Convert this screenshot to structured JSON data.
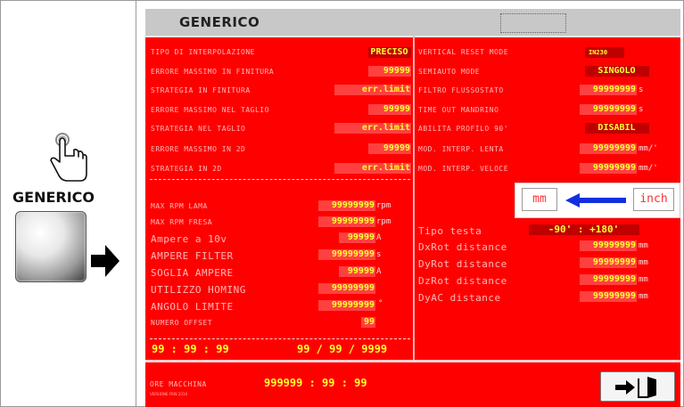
{
  "left": {
    "label": "GENERICO",
    "icon": "pointer-hand-icon",
    "button_icon": "gray-button-icon",
    "arrow_icon": "right-arrow-icon"
  },
  "title": {
    "text": "GENERICO"
  },
  "left_params": [
    {
      "label": "TIPO DI INTERPOLAZIONE",
      "value": "PRECISO"
    },
    {
      "label": "ERRORE MASSIMO IN FINITURA",
      "value": "99999"
    },
    {
      "label": "STRATEGIA IN FINITURA",
      "value": "err.limit"
    },
    {
      "label": "ERRORE MASSIMO NEL TAGLIO",
      "value": "99999"
    },
    {
      "label": "STRATEGIA NEL TAGLIO",
      "value": "err.limit"
    },
    {
      "label": "ERRORE MASSIMO IN 2D",
      "value": "99999"
    },
    {
      "label": "STRATEGIA IN 2D",
      "value": "err.limit"
    }
  ],
  "machine_params": [
    {
      "label": "MAX RPM LAMA",
      "value": "99999999",
      "unit": "rpm"
    },
    {
      "label": "MAX RPM FRESA",
      "value": "99999999",
      "unit": "rpm"
    },
    {
      "label": "Ampere a 10v",
      "value": "99999",
      "unit": "A"
    },
    {
      "label": "AMPERE FILTER",
      "value": "99999999",
      "unit": "s"
    },
    {
      "label": "SOGLIA AMPERE",
      "value": "99999",
      "unit": "A"
    },
    {
      "label": "UTILIZZO HOMING",
      "value": "99999999",
      "unit": ""
    },
    {
      "label": "ANGOLO LIMITE",
      "value": "99999999",
      "unit": "°"
    },
    {
      "label": "NUMERO OFFSET",
      "value": "99",
      "unit": ""
    }
  ],
  "time_display": "99 : 99 : 99",
  "date_display": "99 / 99 / 9999",
  "right_params": [
    {
      "label": "VERTICAL RESET MODE",
      "value": "IN230"
    },
    {
      "label": "SEMIAUTO MODE",
      "value": "SINGOLO"
    },
    {
      "label": "FILTRO FLUSSOSTATO",
      "value": "99999999",
      "unit": "s"
    },
    {
      "label": "TIME OUT MANDRINO",
      "value": "99999999",
      "unit": "s"
    },
    {
      "label": "ABILITA PROFILO 90'",
      "value": "DISABIL"
    },
    {
      "label": "MOD. INTERP. LENTA",
      "value": "99999999",
      "unit": "mm/'"
    },
    {
      "label": "MOD. INTERP. VELOCE",
      "value": "99999999",
      "unit": "mm/'"
    }
  ],
  "units": {
    "mm": "mm",
    "inch": "inch",
    "arrow_icon": "left-arrow-icon"
  },
  "head": {
    "label": "Tipo testa",
    "value": "-90' : +180'"
  },
  "head_params": [
    {
      "label": "DxRot distance",
      "value": "99999999",
      "unit": "mm"
    },
    {
      "label": "DyRot distance",
      "value": "99999999",
      "unit": "mm"
    },
    {
      "label": "DzRot distance",
      "value": "99999999",
      "unit": "mm"
    },
    {
      "label": "DyAC distance",
      "value": "99999999",
      "unit": "mm"
    }
  ],
  "footer": {
    "hours_label": "ORE MACCHINA",
    "hours_value": "999999 : 99 : 99",
    "version": "VERSIONE FRW 2010"
  },
  "exit": {
    "icon": "exit-door-icon"
  },
  "colors": {
    "panel": "#ff0000",
    "value_text": "#ffff30",
    "title_bar": "#c8c8c8"
  }
}
